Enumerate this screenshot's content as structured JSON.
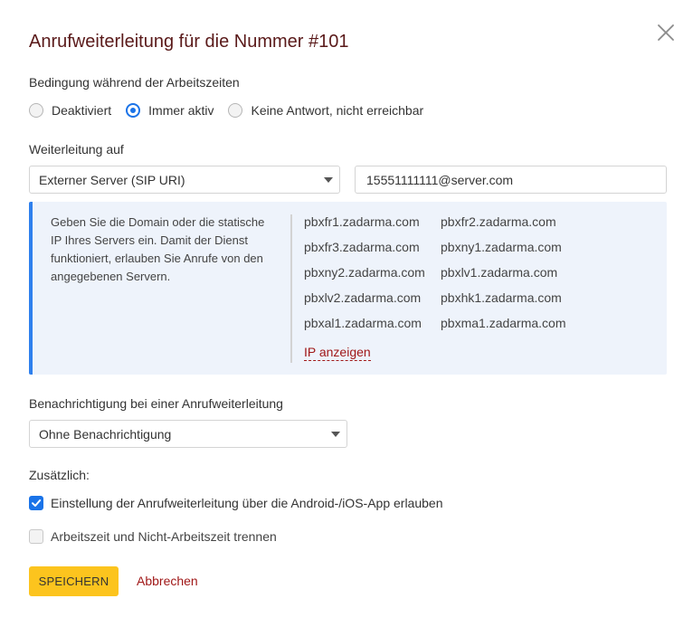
{
  "dialog": {
    "title": "Anrufweiterleitung für die Nummer #101",
    "close_icon": "close-icon"
  },
  "condition": {
    "label": "Bedingung während der Arbeitszeiten",
    "options": [
      {
        "label": "Deaktiviert",
        "checked": false
      },
      {
        "label": "Immer aktiv",
        "checked": true
      },
      {
        "label": "Keine Antwort, nicht erreichbar",
        "checked": false
      }
    ]
  },
  "forwarding": {
    "label": "Weiterleitung auf",
    "target_select": "Externer Server (SIP URI)",
    "target_value": "15551111111@server.com"
  },
  "info": {
    "text": "Geben Sie die Domain oder die statische IP Ihres Servers ein. Damit der Dienst funktioniert, erlauben Sie Anrufe von den angegebenen Servern.",
    "servers": [
      "pbxfr1.zadarma.com",
      "pbxfr2.zadarma.com",
      "pbxfr3.zadarma.com",
      "pbxny1.zadarma.com",
      "pbxny2.zadarma.com",
      "pbxlv1.zadarma.com",
      "pbxlv2.zadarma.com",
      "pbxhk1.zadarma.com",
      "pbxal1.zadarma.com",
      "pbxma1.zadarma.com"
    ],
    "show_ip_link": "IP anzeigen",
    "accent_color": "#2f80ed"
  },
  "notification": {
    "label": "Benachrichtigung bei einer Anrufweiterleitung",
    "select_value": "Ohne Benachrichtigung"
  },
  "additional": {
    "label": "Zusätzlich:",
    "options": [
      {
        "label": "Einstellung der Anrufweiterleitung über die Android-/iOS-App erlauben",
        "checked": true
      },
      {
        "label": "Arbeitszeit und Nicht-Arbeitszeit trennen",
        "checked": false
      }
    ]
  },
  "actions": {
    "save_label": "SPEICHERN",
    "cancel_label": "Abbrechen",
    "save_color": "#fcc41e",
    "cancel_color": "#a01818"
  }
}
